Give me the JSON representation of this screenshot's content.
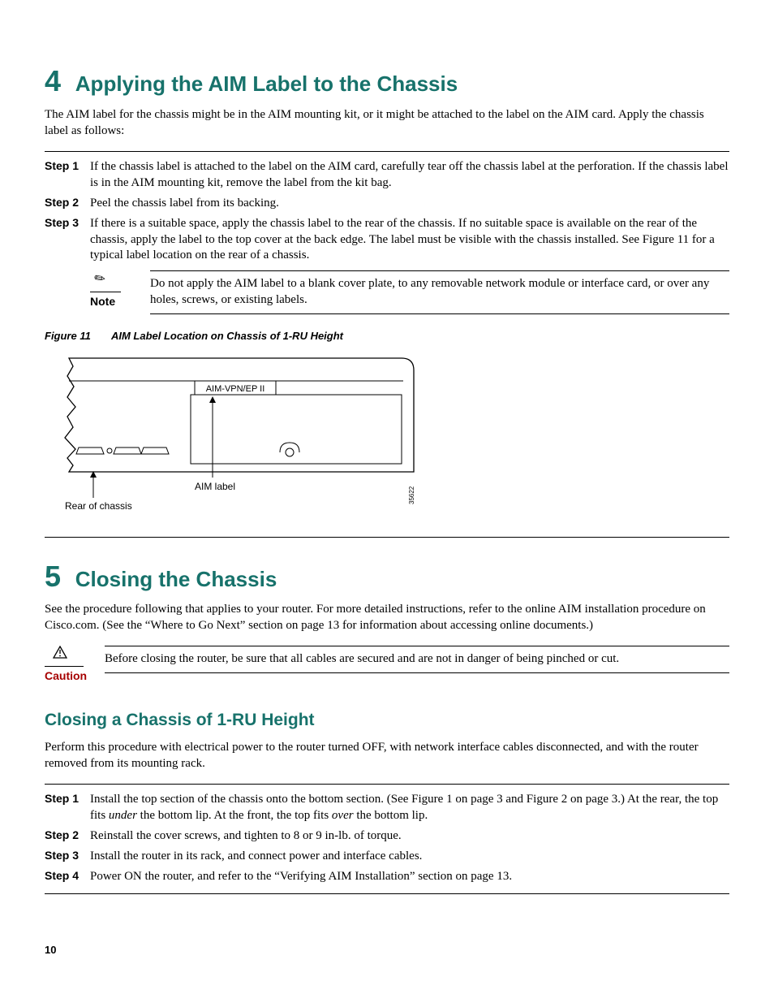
{
  "section4": {
    "number": "4",
    "title": "Applying the AIM Label to the Chassis",
    "intro": "The AIM label for the chassis might be in the AIM mounting kit, or it might be attached to the label on the AIM card. Apply the chassis label as follows:",
    "steps": [
      {
        "label": "Step 1",
        "text": "If the chassis label is attached to the label on the AIM card, carefully tear off the chassis label at the perforation. If the chassis label is in the AIM mounting kit, remove the label from the kit bag."
      },
      {
        "label": "Step 2",
        "text": "Peel the chassis label from its backing."
      },
      {
        "label": "Step 3",
        "text": "If there is a suitable space, apply the chassis label to the rear of the chassis. If no suitable space is available on the rear of the chassis, apply the label to the top cover at the back edge. The label must be visible with the chassis installed. See Figure 11 for a typical label location on the rear of a chassis."
      }
    ],
    "note": {
      "label": "Note",
      "text": "Do not apply the AIM label to a blank cover plate, to any removable network module or interface card, or over any holes, screws, or existing labels."
    },
    "figure": {
      "num": "Figure 11",
      "title": "AIM Label Location on Chassis of 1-RU Height",
      "label_box": "AIM-VPN/EP II",
      "aim_label": "AIM label",
      "rear_label": "Rear of chassis",
      "drawing_number": "35622"
    }
  },
  "section5": {
    "number": "5",
    "title": "Closing the Chassis",
    "intro": "See the procedure following that applies to your router. For more detailed instructions, refer to the online AIM installation procedure on Cisco.com. (See the “Where to Go Next” section on page 13 for information about accessing online documents.)",
    "caution": {
      "label": "Caution",
      "text": "Before closing the router, be sure that all cables are secured and are not in danger of being pinched or cut."
    },
    "subsection": {
      "title": "Closing a Chassis of 1-RU Height",
      "intro": "Perform this procedure with electrical power to the router turned OFF, with network interface cables disconnected, and with the router removed from its mounting rack.",
      "steps": [
        {
          "label": "Step 1",
          "text_pre": "Install the top section of the chassis onto the bottom section. (See Figure 1 on page 3 and Figure 2 on page 3.) At the rear, the top fits ",
          "italic1": "under",
          "mid": " the bottom lip. At the front, the top fits ",
          "italic2": "over",
          "post": " the bottom lip."
        },
        {
          "label": "Step 2",
          "text": "Reinstall the cover screws, and tighten to 8 or 9 in-lb. of torque."
        },
        {
          "label": "Step 3",
          "text": "Install the router in its rack, and connect power and interface cables."
        },
        {
          "label": "Step 4",
          "text": "Power ON the router, and refer to the “Verifying AIM Installation” section on page 13."
        }
      ]
    }
  },
  "page_number": "10"
}
